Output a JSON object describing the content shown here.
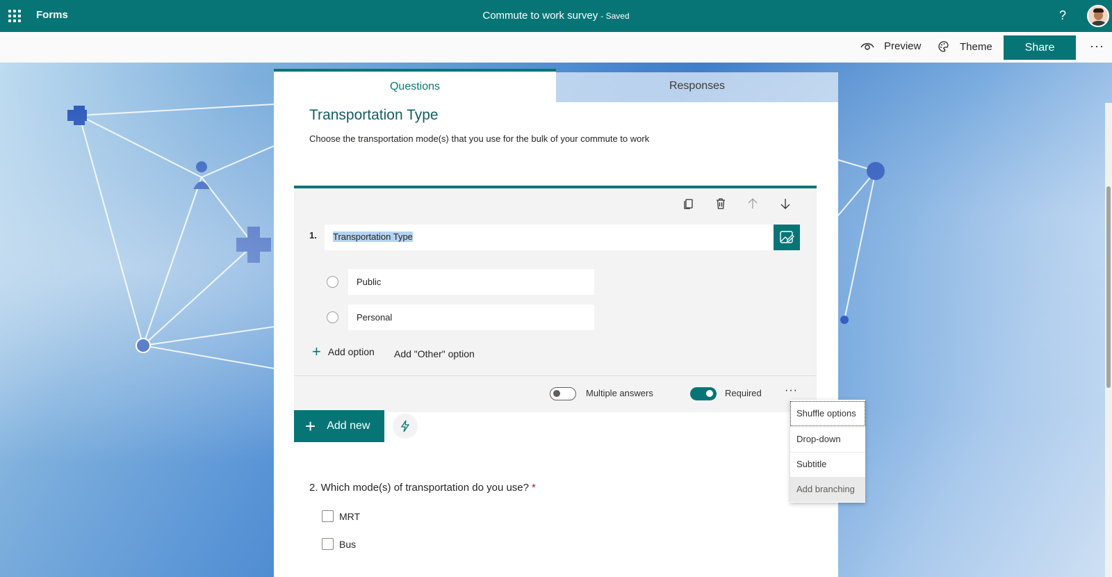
{
  "topbar": {
    "app_name": "Forms",
    "title": "Commute to work survey",
    "saved": "- Saved",
    "help": "?",
    "bg_color": "#077575"
  },
  "commands": {
    "preview": "Preview",
    "theme": "Theme",
    "share": "Share",
    "more": "···"
  },
  "tabs": {
    "questions": "Questions",
    "responses": "Responses"
  },
  "section": {
    "title": "Transportation Type",
    "subtitle": "Choose the transportation mode(s) that you use for the bulk of your commute to work"
  },
  "question1": {
    "number": "1.",
    "title": "Transportation Type",
    "options": [
      "Public",
      "Personal"
    ],
    "add_option": "Add option",
    "add_other": "Add \"Other\" option",
    "multiple_answers_label": "Multiple answers",
    "multiple_answers_on": false,
    "required_label": "Required",
    "required_on": true,
    "more": "···"
  },
  "add_new": "Add new",
  "menu": {
    "items": [
      "Shuffle options",
      "Drop-down",
      "Subtitle",
      "Add branching"
    ]
  },
  "question2": {
    "title": "2. Which mode(s) of transportation do you use?",
    "required_mark": "*",
    "options": [
      "MRT",
      "Bus"
    ]
  }
}
